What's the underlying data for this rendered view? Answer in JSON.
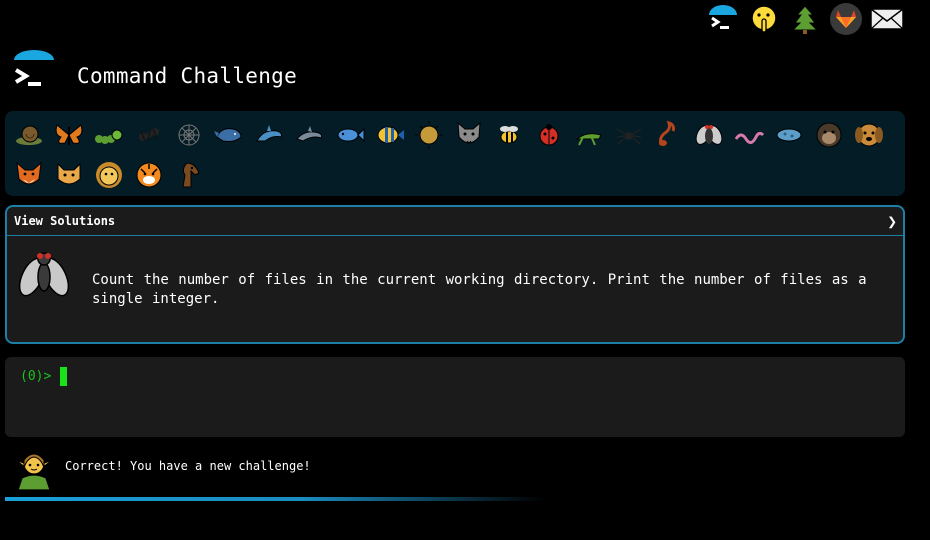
{
  "app": {
    "title": "Command Challenge"
  },
  "toolbar": {
    "items": [
      {
        "name": "terminal-logo-button",
        "icon": "terminal-umbrella-icon"
      },
      {
        "name": "shushing-face-button",
        "icon": "shushing-face-icon"
      },
      {
        "name": "tree-button",
        "icon": "evergreen-tree-icon"
      },
      {
        "name": "gitlab-button",
        "icon": "gitlab-icon"
      },
      {
        "name": "email-button",
        "icon": "envelope-icon"
      }
    ]
  },
  "gallery": {
    "animals": [
      "snail",
      "butterfly",
      "caterpillar",
      "ant",
      "spider-web",
      "whale",
      "dolphin",
      "dolphin-2",
      "fish",
      "tropical-fish",
      "blowfish",
      "wolf",
      "bee",
      "ladybug",
      "cricket",
      "spider",
      "scorpion",
      "fly",
      "worm",
      "microbe",
      "gorilla",
      "dog",
      "fox",
      "cat",
      "lion",
      "tiger",
      "horse"
    ]
  },
  "challenge": {
    "solutions_label": "View Solutions",
    "chevron": "❯",
    "text": "Count the number of files in the current working directory. Print the number of files as a single integer.",
    "mascot": "fly-icon"
  },
  "terminal": {
    "prompt": "(0)>"
  },
  "status": {
    "message": "Correct! You have a new challenge!",
    "mascot": "elf-icon",
    "progress": 0.58
  },
  "colors": {
    "accent": "#1e7ea6",
    "prompt": "#1dc11d",
    "gallery_bg": "#041c26",
    "panel_bg": "#1b1b1b"
  }
}
